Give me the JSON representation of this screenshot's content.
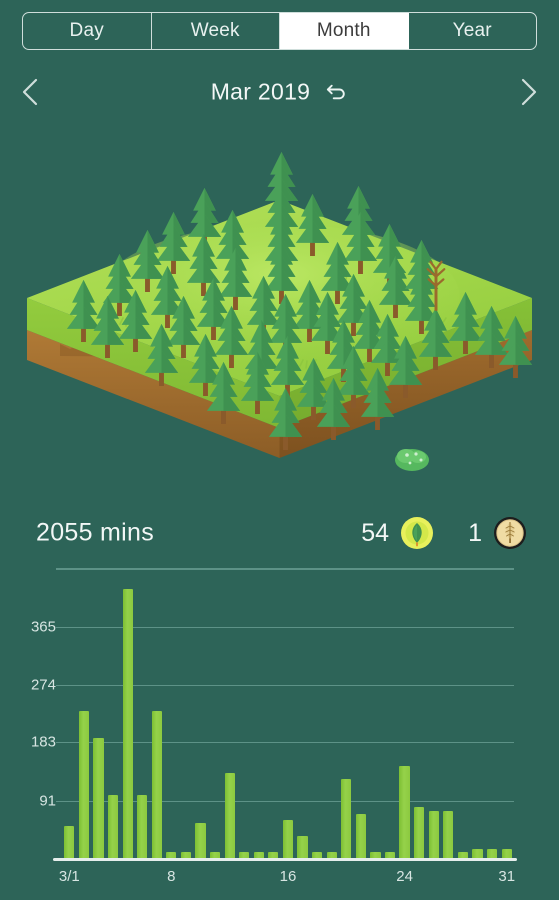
{
  "tabs": [
    {
      "label": "Day",
      "active": false
    },
    {
      "label": "Week",
      "active": false
    },
    {
      "label": "Month",
      "active": true
    },
    {
      "label": "Year",
      "active": false
    }
  ],
  "datenav": {
    "prev_icon": "chevron-left-icon",
    "next_icon": "chevron-right-icon",
    "period_label": "Mar 2019",
    "reset_icon": "undo-arrow-icon"
  },
  "scene": {
    "name": "isometric-forest-island",
    "ground_top_color": "#a5da4a",
    "ground_side_color": "#8cc63f",
    "soil_color": "#a8702f",
    "tree_color": "#4a9c52",
    "background_color": "#2d6458"
  },
  "stats": {
    "total_time": "2055 mins",
    "leaf_count": "54",
    "leaf_badge_icon": "leaf-badge-icon",
    "tree_count": "1",
    "tree_badge_icon": "tree-coin-badge-icon"
  },
  "colors": {
    "background": "#2d6458",
    "bar": "#8cc93f",
    "accent_text": "#f2f7f6",
    "gridline": "#5d9287",
    "active_tab_bg": "#ffffff",
    "active_tab_text": "#3c3c3c"
  },
  "chart_data": {
    "type": "bar",
    "title": "",
    "xlabel": "",
    "ylabel": "",
    "grid": true,
    "ylim": [
      0,
      440
    ],
    "yticks": [
      91,
      183,
      274,
      365
    ],
    "ytick_labels": [
      "91",
      "183",
      "274",
      "365"
    ],
    "xtick_positions": [
      1,
      8,
      16,
      24,
      31
    ],
    "xtick_labels": [
      "3/1",
      "8",
      "16",
      "24",
      "31"
    ],
    "categories": [
      "1",
      "2",
      "3",
      "4",
      "5",
      "6",
      "7",
      "8",
      "9",
      "10",
      "11",
      "12",
      "13",
      "14",
      "15",
      "16",
      "17",
      "18",
      "19",
      "20",
      "21",
      "22",
      "23",
      "24",
      "25",
      "26",
      "27",
      "28",
      "29",
      "30",
      "31"
    ],
    "values": [
      50,
      233,
      190,
      100,
      425,
      100,
      232,
      10,
      10,
      55,
      10,
      135,
      10,
      10,
      10,
      60,
      35,
      10,
      10,
      125,
      70,
      10,
      10,
      145,
      80,
      75,
      75,
      10,
      15,
      15,
      15
    ]
  }
}
